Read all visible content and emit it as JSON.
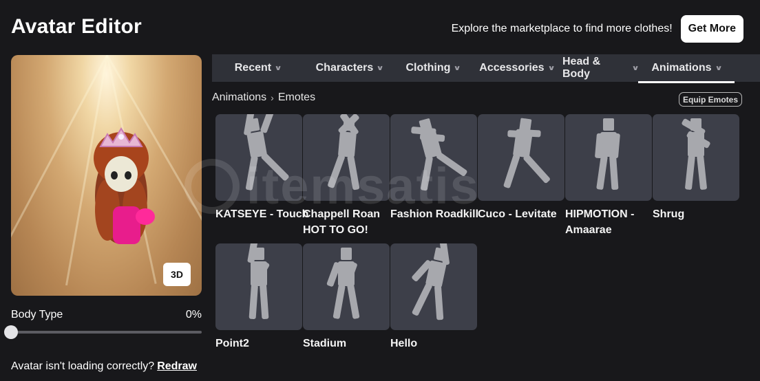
{
  "header": {
    "title": "Avatar Editor",
    "promo_text": "Explore the marketplace to find more clothes!",
    "get_more_label": "Get More"
  },
  "preview": {
    "button_3d_label": "3D",
    "body_type_label": "Body Type",
    "body_type_value": "0%",
    "body_type_fraction": 0,
    "loading_text": "Avatar isn't loading correctly?",
    "redraw_label": "Redraw"
  },
  "nav": {
    "tabs": [
      {
        "label": "Recent",
        "active": false
      },
      {
        "label": "Characters",
        "active": false
      },
      {
        "label": "Clothing",
        "active": false
      },
      {
        "label": "Accessories",
        "active": false
      },
      {
        "label": "Head & Body",
        "active": false
      },
      {
        "label": "Animations",
        "active": true
      }
    ]
  },
  "breadcrumb": {
    "root": "Animations",
    "current": "Emotes"
  },
  "equip_emotes_label": "Equip Emotes",
  "watermark_text": "itemsatis",
  "items": [
    {
      "line1": "KATSEYE - Touch",
      "line2": "",
      "pose": "touch"
    },
    {
      "line1": "Chappell Roan",
      "line2": "HOT TO GO!",
      "pose": "hottogo"
    },
    {
      "line1": "Fashion Roadkill",
      "line2": "",
      "pose": "roadkill"
    },
    {
      "line1": "Cuco - Levitate",
      "line2": "",
      "pose": "levitate"
    },
    {
      "line1": "HIPMOTION -",
      "line2": "Amaarae",
      "pose": "hipmotion"
    },
    {
      "line1": "Shrug",
      "line2": "",
      "pose": "shrug"
    },
    {
      "line1": "Point2",
      "line2": "",
      "pose": "point"
    },
    {
      "line1": "Stadium",
      "line2": "",
      "pose": "stadium"
    },
    {
      "line1": "Hello",
      "line2": "",
      "pose": "hello"
    }
  ],
  "colors": {
    "background": "#18181b",
    "nav_bg": "#2f3138",
    "tile_bg": "#3d3f49",
    "figure": "#a7a8ad"
  }
}
